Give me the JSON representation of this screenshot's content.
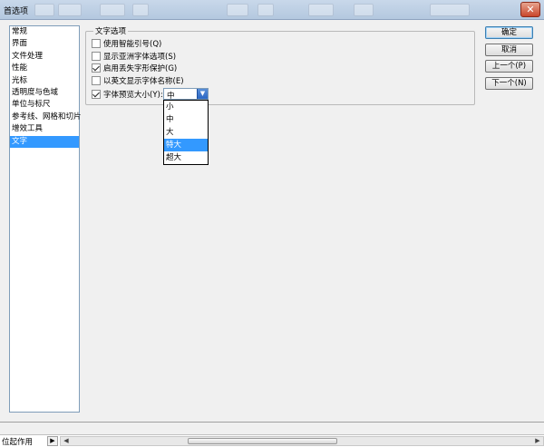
{
  "window": {
    "title": "首选项",
    "close_glyph": "✕"
  },
  "sidebar": {
    "items": [
      {
        "label": "常规"
      },
      {
        "label": "界面"
      },
      {
        "label": "文件处理"
      },
      {
        "label": "性能"
      },
      {
        "label": "光标"
      },
      {
        "label": "透明度与色域"
      },
      {
        "label": "单位与标尺"
      },
      {
        "label": "参考线、网格和切片"
      },
      {
        "label": "增效工具"
      },
      {
        "label": "文字"
      }
    ],
    "selected_index": 9
  },
  "text_options": {
    "group_label": "文字选项",
    "options": [
      {
        "label": "使用智能引号(Q)",
        "checked": false
      },
      {
        "label": "显示亚洲字体选项(S)",
        "checked": false
      },
      {
        "label": "启用丢失字形保护(G)",
        "checked": true
      },
      {
        "label": "以英文显示字体名称(E)",
        "checked": false
      },
      {
        "label": "字体预览大小(Y):",
        "checked": true
      }
    ],
    "preview_size": {
      "value": "中",
      "arrow_glyph": "▼",
      "options": [
        "小",
        "中",
        "大",
        "特大",
        "超大"
      ],
      "highlighted": "特大"
    }
  },
  "buttons": {
    "ok": "确定",
    "cancel": "取消",
    "prev": "上一个(P)",
    "next": "下一个(N)"
  },
  "statusbar": {
    "text": "位起作用",
    "arrow_glyph": "▶",
    "scroll_left_glyph": "◀",
    "scroll_right_glyph": "▶"
  }
}
